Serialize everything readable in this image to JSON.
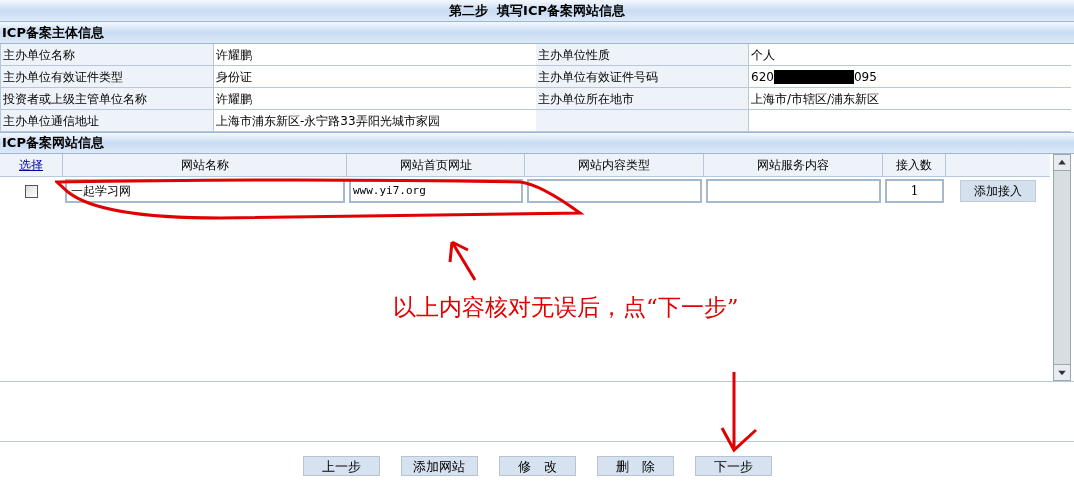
{
  "window": {
    "title": "第二步  填写ICP备案网站信息"
  },
  "subject": {
    "title": "ICP备案主体信息",
    "rows": [
      {
        "cells": [
          {
            "label": "主办单位名称",
            "value": "许耀鹏"
          },
          {
            "label": "主办单位性质",
            "value": "个人"
          }
        ]
      },
      {
        "cells": [
          {
            "label": "主办单位有效证件类型",
            "value": "身份证"
          },
          {
            "label": "主办单位有效证件号码",
            "value_start": "620",
            "value_end": "095",
            "redacted": true
          }
        ]
      },
      {
        "cells": [
          {
            "label": "投资者或上级主管单位名称",
            "value": "许耀鹏"
          },
          {
            "label": "主办单位所在地市",
            "value": "上海市/市辖区/浦东新区"
          }
        ]
      },
      {
        "cells": [
          {
            "label": "主办单位通信地址",
            "value": "上海市浦东新区-永宁路33弄阳光城市家园"
          },
          {}
        ]
      }
    ]
  },
  "websites": {
    "title": "ICP备案网站信息",
    "columns": [
      "选择",
      "网站名称",
      "网站首页网址",
      "网站内容类型",
      "网站服务内容",
      "接入数"
    ],
    "rows": [
      {
        "checked": false,
        "name": "一起学习网",
        "url": "www.yi7.org",
        "content_type": "",
        "service": "",
        "count": "1",
        "action": "添加接入"
      }
    ]
  },
  "annotation": {
    "text": "以上内容核对无误后，点“下一步”"
  },
  "buttons": [
    "上一步",
    "添加网站",
    "修　改",
    "删　除",
    "下一步"
  ]
}
